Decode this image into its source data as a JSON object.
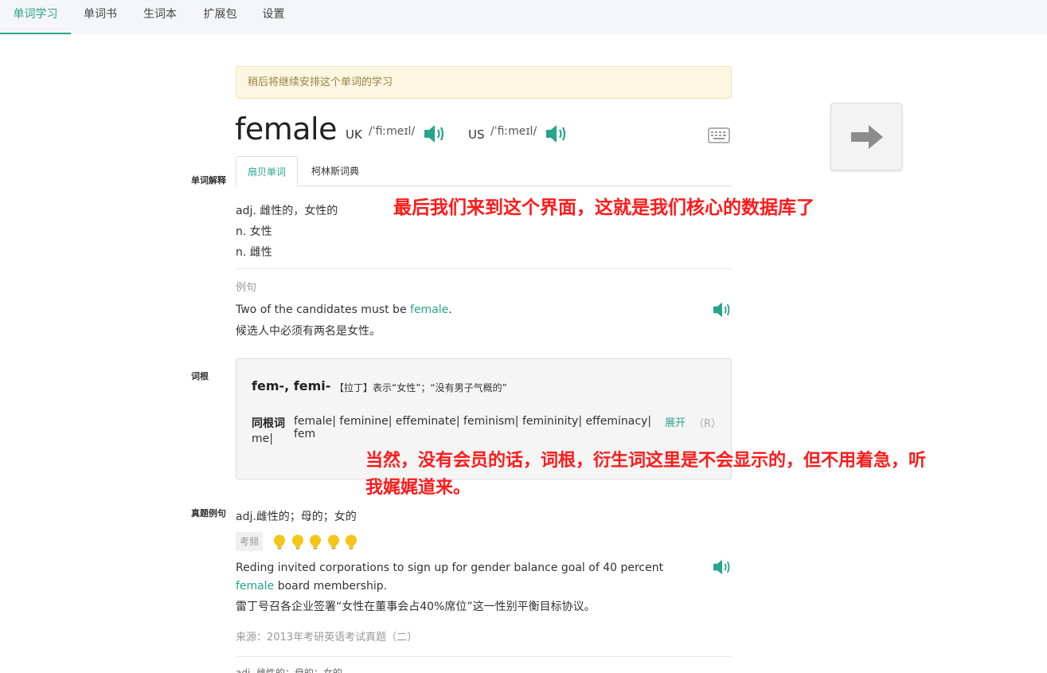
{
  "nav": {
    "items": [
      "单词学习",
      "单词书",
      "生词本",
      "扩展包",
      "设置"
    ],
    "active_index": 0
  },
  "notice": "稍后将继续安排这个单词的学习",
  "word": {
    "text": "female",
    "uk_label": "UK",
    "uk_phonetic": "/ˈfiːmeɪl/",
    "us_label": "US",
    "us_phonetic": "/ˈfiːmeɪl/"
  },
  "sections": {
    "definition": "单词解释",
    "root": "词根",
    "real_examples": "真题例句"
  },
  "tabs": [
    "扇贝单词",
    "柯林斯词典"
  ],
  "definitions": [
    "adj. 雌性的，女性的",
    "n. 女性",
    "n. 雌性"
  ],
  "example": {
    "label": "例句",
    "en_before": "Two of the candidates must be ",
    "en_highlight": "female",
    "en_after": ".",
    "zh": "候选人中必须有两名是女性。"
  },
  "root": {
    "title": "fem-, femi-",
    "desc": "【拉丁】表示“女性”；“没有男子气概的”",
    "cognates_label": "同根词",
    "cognates_line1": "female|  feminine|  effeminate|  feminism|  femininity|  effeminacy|  fem",
    "cognates_line2": "me|",
    "expand_label": "展开",
    "expand_key": "（R）"
  },
  "real_example": {
    "def": "adj.雌性的；母的；女的",
    "freq_label": "考频",
    "freq_level": 5,
    "en_before": "Reding invited corporations to sign up for gender balance goal of 40 percent ",
    "en_highlight": "female",
    "en_after": " board membership.",
    "zh": "雷丁号召各企业签署“女性在董事会占40%席位”这一性别平衡目标协议。",
    "source": "来源：2013年考研英语考试真题（二）"
  },
  "partial_text": "adj. 雌性的；母的；女的",
  "annotations": {
    "a1": "最后我们来到这个界面，这就是我们核心的数据库了",
    "a2_line1": "当然，没有会员的话，词根，衍生词这里是不会显示的，但不用着急，听",
    "a2_line2": "我娓娓道来。"
  },
  "colors": {
    "accent": "#28a48b",
    "annotation": "#ff1a1a",
    "notice_bg": "#fdf6e0"
  }
}
